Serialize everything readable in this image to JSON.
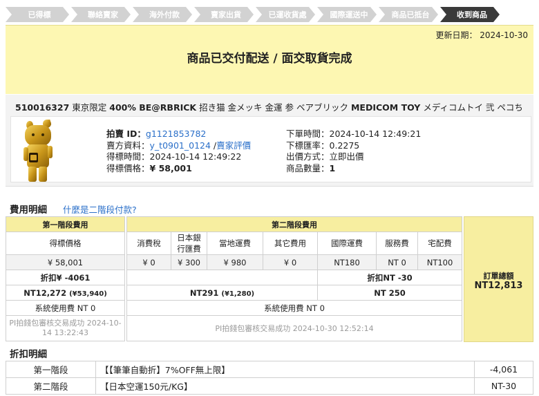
{
  "steps": [
    {
      "label": "已得標",
      "active": false
    },
    {
      "label": "聯絡賣家",
      "active": false
    },
    {
      "label": "海外付款",
      "active": false
    },
    {
      "label": "賣家出貨",
      "active": false
    },
    {
      "label": "已運收貨處",
      "active": false
    },
    {
      "label": "國際運送中",
      "active": false
    },
    {
      "label": "商品已抵台",
      "active": false
    },
    {
      "label": "收到商品",
      "active": true
    }
  ],
  "banner": {
    "updated": "更新日期： 2024-10-30",
    "status": "商品已交付配送 / 面交取貨完成"
  },
  "product": {
    "id": "510016327",
    "title_a": "東京限定",
    "title_b": "400% BE@RBRICK",
    "title_c": "招き猫 金メッキ 金運 参 ベアブリック",
    "title_d": "MEDICOM TOY",
    "title_e": "メディコムトイ 弐 ペコち",
    "bid_id_label": "拍賣 ID：",
    "bid_id": "g1121853782",
    "seller_label": "賣方資料：",
    "seller": "y_t0901_0124",
    "seller_sep": " /",
    "seller_review": "賣家評價",
    "win_time_label": "得標時間：",
    "win_time": "2024-10-14 12:49:22",
    "win_price_label": "得標價格：",
    "win_price": "¥ 58,001",
    "order_time_label": "下單時間：",
    "order_time": "2024-10-14 12:49:21",
    "rate_label": "下標匯率：",
    "rate": "0.2275",
    "method_label": "出價方式：",
    "method": "立即出價",
    "qty_label": "商品數量：",
    "qty": "1"
  },
  "fees": {
    "section_title": "費用明細",
    "help_link": "什麼是二階段付款?",
    "stage1_header": "第一階段費用",
    "stage2_header": "第二階段費用",
    "col_win_price": "得標價格",
    "col_tax": "消費稅",
    "col_bank_1": "日本銀",
    "col_bank_2": "行匯費",
    "col_local_ship": "當地運費",
    "col_other": "其它費用",
    "col_intl_ship": "國際運費",
    "col_service": "服務費",
    "col_delivery": "宅配費",
    "val_win_price": "¥ 58,001",
    "val_tax": "¥ 0",
    "val_bank": "¥ 300",
    "val_local_ship": "¥ 980",
    "val_other": "¥ 0",
    "val_intl_ship": "NT180",
    "val_service": "NT 0",
    "val_delivery": "NT100",
    "s1_discount": "折扣¥ -4061",
    "s2_discount": "折扣NT -30",
    "s1_total_nt": "NT12,272",
    "s1_total_yen": "(¥53,940)",
    "s2a_total_nt": "NT291",
    "s2a_total_yen": "(¥1,280)",
    "s2b_total": "NT 250",
    "s1_sys_fee": "系統使用費 NT 0",
    "s2_sys_fee": "系統使用費 NT 0",
    "s1_paid": "PI拍錢包審核交易成功 2024-10-14 13:22:43",
    "s2_paid": "PI拍錢包審核交易成功 2024-10-30 12:52:14",
    "order_total_label": "訂單總額",
    "order_total": "NT12,813"
  },
  "discounts": {
    "section_title": "折扣明細",
    "rows": [
      {
        "stage": "第一階段",
        "desc": "【【筆筆自動折】7%OFF無上限】",
        "amount": "-4,061"
      },
      {
        "stage": "第二階段",
        "desc": "【日本空運150元/KG】",
        "amount": "NT-30"
      }
    ]
  },
  "colors": {
    "banner_bg": "#fdf7b2",
    "header_yellow": "#f7eea0",
    "step_inactive": "#d2d2d2",
    "step_active": "#3a3a3a",
    "link_blue": "#2a6fc9"
  }
}
